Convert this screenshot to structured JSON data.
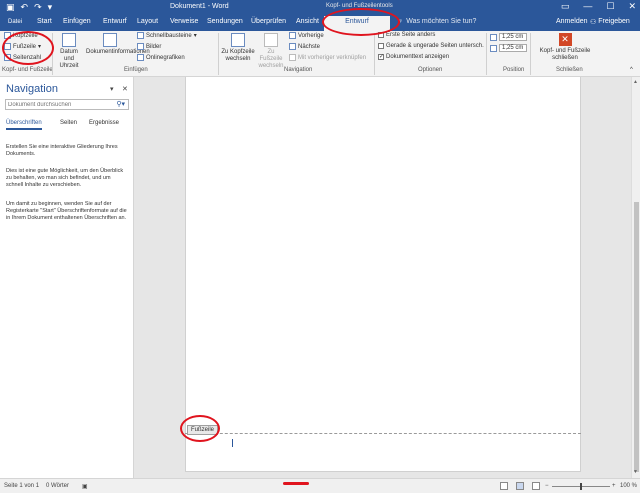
{
  "titlebar": {
    "document_title": "Dokument1 - Word",
    "context_title": "Kopf- und Fußzeilentools",
    "qat": {
      "save_icon": "save-icon",
      "undo_glyph": "↶",
      "redo_glyph": "↷",
      "customize_glyph": "▾"
    },
    "window_controls": {
      "minimize": "—",
      "maximize": "☐",
      "close": "✕"
    }
  },
  "tabs": {
    "file": "Datei",
    "items": [
      "Start",
      "Einfügen",
      "Entwurf",
      "Layout",
      "Verweise",
      "Sendungen",
      "Überprüfen",
      "Ansicht"
    ],
    "active": "Entwurf",
    "tell_me": "Was möchten Sie tun?",
    "tell_me_icon": "lightbulb-icon",
    "signin": "Anmelden",
    "share": "Freigeben",
    "share_icon": "person-icon"
  },
  "ribbon": {
    "groups": [
      {
        "label": "Kopf- und Fußzeile",
        "items": [
          "Kopfzeile",
          "Fußzeile",
          "Seitenzahl"
        ]
      },
      {
        "label": "Einfügen",
        "items": [
          "Datum und Uhrzeit",
          "Dokumentinformationen",
          "Schnellbausteine",
          "Bilder",
          "Onlinegrafiken"
        ]
      },
      {
        "label": "Navigation",
        "items": [
          "Zu Kopfzeile wechseln",
          "Zu Fußzeile wechseln",
          "Vorherige",
          "Nächste",
          "Mit vorheriger verknüpfen"
        ]
      },
      {
        "label": "Optionen",
        "items": [
          "Erste Seite anders",
          "Gerade & ungerade Seiten untersch.",
          "Dokumenttext anzeigen"
        ]
      },
      {
        "label": "Position",
        "items": [
          "1,25 cm",
          "1,25 cm"
        ]
      },
      {
        "label": "Schließen",
        "items": [
          "Kopf- und Fußzeile schließen"
        ]
      }
    ],
    "dropdown_glyph": "▾",
    "checked_glyph": "✓",
    "close_glyph": "✕"
  },
  "navigation_pane": {
    "title": "Navigation",
    "dropdown_glyph": "▾",
    "close_glyph": "✕",
    "search_placeholder": "Dokument durchsuchen",
    "search_icon_glyph": "⚲",
    "search_dropdown_glyph": "▾",
    "tabs": [
      "Überschriften",
      "Seiten",
      "Ergebnisse"
    ],
    "active_tab": "Überschriften",
    "paragraphs": [
      "Erstellen Sie eine interaktive Gliederung Ihres Dokuments.",
      "Dies ist eine gute Möglichkeit, um den Überblick zu behalten, wo man sich befindet, und um schnell Inhalte zu verschieben.",
      "Um damit zu beginnen, wenden Sie auf der Registerkarte \"Start\" Überschriftenformate auf die in Ihrem Dokument enthaltenen Überschriften an."
    ]
  },
  "document": {
    "footer_label": "Fußzeile"
  },
  "statusbar": {
    "page": "Seite 1 von 1",
    "words": "0 Wörter",
    "proofing_icon": "proofing-icon",
    "zoom_minus": "−",
    "zoom_plus": "+",
    "zoom": "100 %"
  },
  "colors": {
    "accent": "#2b579a",
    "annotation": "#e0141e",
    "close_button": "#d24726"
  }
}
